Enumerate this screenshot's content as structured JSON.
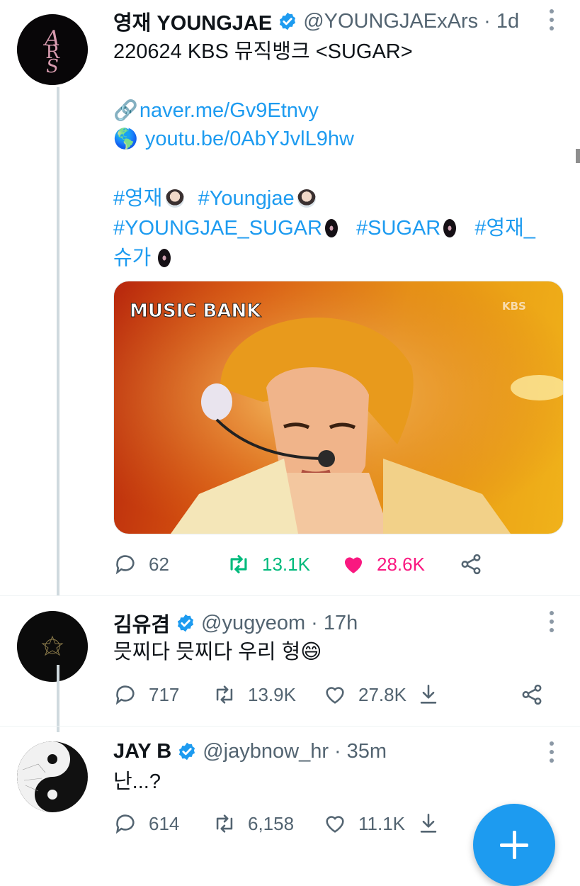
{
  "tweet": {
    "display_name": "영재 YOUNGJAE",
    "handle": "@YOUNGJAExArs",
    "time": "1d",
    "line1": "220624 KBS 뮤직뱅크 <SUGAR>",
    "link1": "naver.me/Gv9Etnvy",
    "link2": "youtu.be/0AbYJvlL9hw",
    "tags": [
      "#영재",
      "#Youngjae",
      "#YOUNGJAE_SUGAR",
      "#SUGAR",
      "#영재_",
      "슈가"
    ],
    "media": {
      "logo": "MUSIC BANK",
      "watermark": "KBS"
    },
    "replies": "62",
    "retweets": "13.1K",
    "likes": "28.6K"
  },
  "reply1": {
    "display_name": "김유겸",
    "handle": "@yugyeom",
    "time": "17h",
    "text": "믓찌다 믓찌다 우리 형😄",
    "replies": "717",
    "retweets": "13.9K",
    "likes": "27.8K"
  },
  "reply2": {
    "display_name": "JAY B",
    "handle": "@jaybnow_hr",
    "time": "35m",
    "text": "난...?",
    "replies": "614",
    "retweets": "6,158",
    "likes": "11.1K"
  },
  "separator": "·",
  "colors": {
    "accent": "#1d9bf0",
    "retweet_active": "#00ba7c",
    "like_active": "#f91880",
    "muted": "#536471"
  },
  "icons": [
    "verified-badge-icon",
    "more-icon",
    "reply-icon",
    "retweet-icon",
    "like-icon",
    "share-icon",
    "download-icon",
    "link-icon",
    "globe-icon",
    "compose-icon"
  ]
}
